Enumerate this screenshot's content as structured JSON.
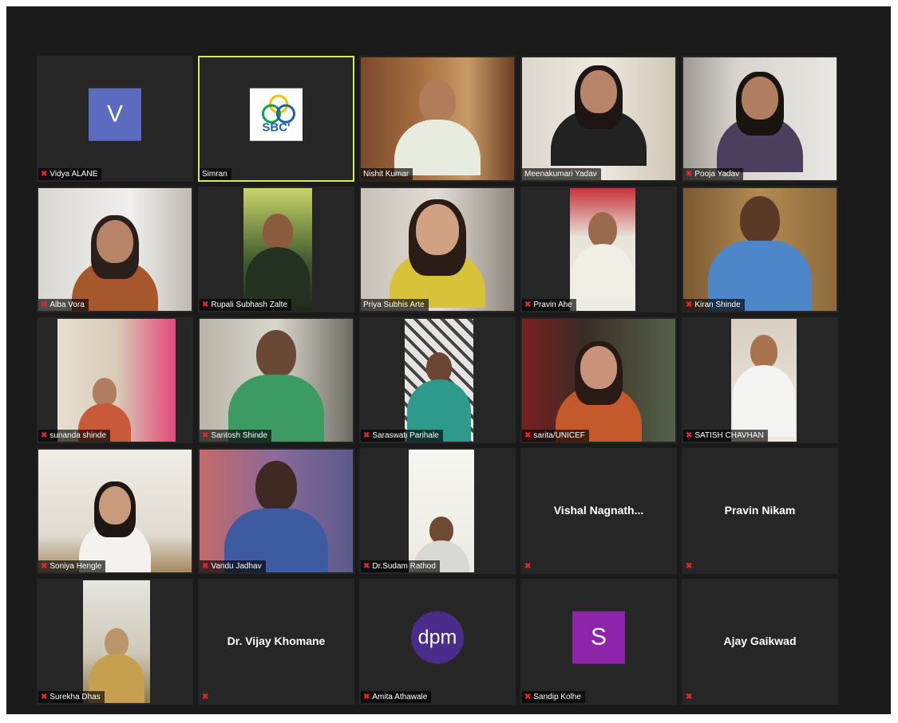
{
  "participants": [
    {
      "name": "Vidya ALANE",
      "muted": true,
      "type": "avatar",
      "initial": "V",
      "color": "#5c6bc0"
    },
    {
      "name": "Simran",
      "muted": false,
      "type": "logo",
      "logo_text": "SBC'",
      "active": true
    },
    {
      "name": "Nishit Kumar",
      "muted": false,
      "type": "video"
    },
    {
      "name": "Meenakumari Yadav",
      "muted": false,
      "type": "video"
    },
    {
      "name": "Pooja Yadav",
      "muted": true,
      "type": "video"
    },
    {
      "name": "Alba Vora",
      "muted": true,
      "type": "video"
    },
    {
      "name": "Rupali Subhash Zalte",
      "muted": true,
      "type": "video"
    },
    {
      "name": "Priya Subhis Arte",
      "muted": false,
      "type": "video"
    },
    {
      "name": "Pravin Ahe",
      "muted": true,
      "type": "video"
    },
    {
      "name": "Kiran Shinde",
      "muted": true,
      "type": "video"
    },
    {
      "name": "sunanda shinde",
      "muted": true,
      "type": "video"
    },
    {
      "name": "Santosh Shinde",
      "muted": true,
      "type": "video"
    },
    {
      "name": "Saraswati Parihale",
      "muted": true,
      "type": "video"
    },
    {
      "name": "sarita/UNICEF",
      "muted": true,
      "type": "video"
    },
    {
      "name": "SATISH CHAVHAN",
      "muted": true,
      "type": "video"
    },
    {
      "name": "Soniya Hengle",
      "muted": true,
      "type": "video"
    },
    {
      "name": "Vandu Jadhav",
      "muted": true,
      "type": "video"
    },
    {
      "name": "Dr.Sudam Rathod",
      "muted": true,
      "type": "video"
    },
    {
      "name": "Vishal Nagnath...",
      "muted": true,
      "type": "name"
    },
    {
      "name": "Pravin Nikam",
      "muted": true,
      "type": "name"
    },
    {
      "name": "Surekha Dhas",
      "muted": true,
      "type": "video"
    },
    {
      "name": "Dr. Vijay Khomane",
      "muted": true,
      "type": "name"
    },
    {
      "name": "Amita Athawale",
      "muted": true,
      "type": "avatar-circle",
      "initial": "dpm",
      "color": "#4b2c8a"
    },
    {
      "name": "Sandip Kolhe",
      "muted": true,
      "type": "avatar",
      "initial": "S",
      "color": "#8e24aa"
    },
    {
      "name": "Ajay Gaikwad",
      "muted": true,
      "type": "name"
    }
  ],
  "icons": {
    "muted": "mic-muted-icon"
  },
  "colors": {
    "active_speaker_border": "#d7e85a",
    "muted_icon": "#e02828",
    "tile_bg": "#262626"
  }
}
